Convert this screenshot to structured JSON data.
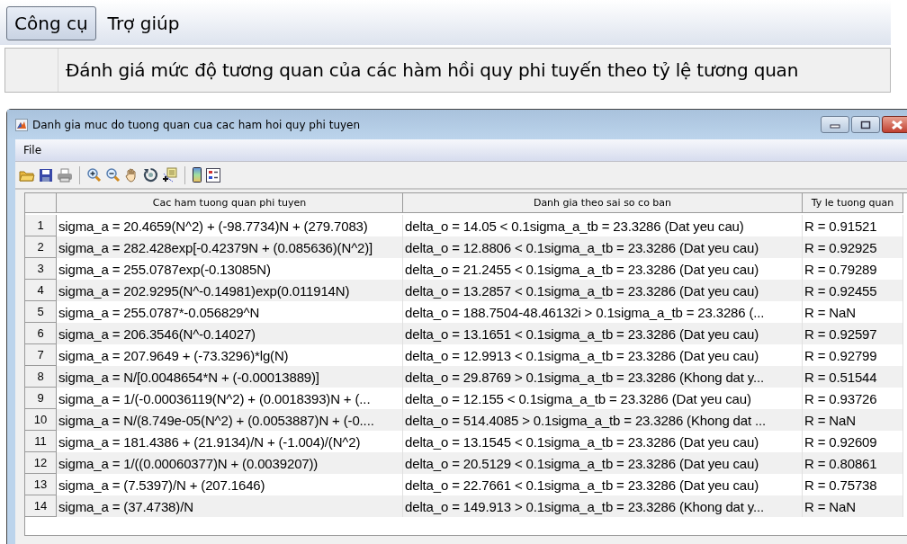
{
  "menu_bar": {
    "items": [
      {
        "label": "Công cụ",
        "selected": true
      },
      {
        "label": "Trợ giúp",
        "selected": false
      }
    ]
  },
  "menu_item": {
    "label": "Đánh giá mức độ tương quan của các hàm hồi quy phi tuyến theo tỷ lệ tương quan"
  },
  "window": {
    "title": "Danh gia muc do tuong quan cua cac ham hoi quy phi tuyen",
    "menu": [
      "File"
    ]
  },
  "table": {
    "columns": [
      "Cac ham tuong quan phi tuyen",
      "Danh gia theo sai so co ban",
      "Ty le tuong quan"
    ],
    "rows": [
      {
        "index": "1",
        "cells": [
          "sigma_a = 20.4659(N^2) + (-98.7734)N + (279.7083)",
          "delta_o = 14.05 < 0.1sigma_a_tb = 23.3286 (Dat yeu cau)",
          "R = 0.91521"
        ]
      },
      {
        "index": "2",
        "cells": [
          "sigma_a = 282.428exp[-0.42379N + (0.085636)(N^2)]",
          "delta_o = 12.8806 < 0.1sigma_a_tb = 23.3286 (Dat yeu cau)",
          "R = 0.92925"
        ]
      },
      {
        "index": "3",
        "cells": [
          "sigma_a = 255.0787exp(-0.13085N)",
          "delta_o = 21.2455 < 0.1sigma_a_tb = 23.3286 (Dat yeu cau)",
          "R = 0.79289"
        ]
      },
      {
        "index": "4",
        "cells": [
          "sigma_a = 202.9295(N^-0.14981)exp(0.011914N)",
          "delta_o = 13.2857 < 0.1sigma_a_tb = 23.3286 (Dat yeu cau)",
          "R = 0.92455"
        ]
      },
      {
        "index": "5",
        "cells": [
          "sigma_a = 255.0787*-0.056829^N",
          "delta_o = 188.7504-48.46132i > 0.1sigma_a_tb = 23.3286 (...",
          "R = NaN"
        ]
      },
      {
        "index": "6",
        "cells": [
          "sigma_a = 206.3546(N^-0.14027)",
          "delta_o = 13.1651 < 0.1sigma_a_tb = 23.3286 (Dat yeu cau)",
          "R = 0.92597"
        ]
      },
      {
        "index": "7",
        "cells": [
          "sigma_a = 207.9649 + (-73.3296)*lg(N)",
          "delta_o = 12.9913 < 0.1sigma_a_tb = 23.3286 (Dat yeu cau)",
          "R = 0.92799"
        ]
      },
      {
        "index": "8",
        "cells": [
          "sigma_a = N/[0.0048654*N + (-0.00013889)]",
          "delta_o = 29.8769 > 0.1sigma_a_tb = 23.3286 (Khong dat y...",
          "R = 0.51544"
        ]
      },
      {
        "index": "9",
        "cells": [
          "sigma_a = 1/(-0.00036119(N^2) + (0.0018393)N + (...",
          "delta_o = 12.155 < 0.1sigma_a_tb = 23.3286 (Dat yeu cau)",
          "R = 0.93726"
        ]
      },
      {
        "index": "10",
        "cells": [
          "sigma_a = N/(8.749e-05(N^2) + (0.0053887)N + (-0....",
          "delta_o = 514.4085 > 0.1sigma_a_tb = 23.3286 (Khong dat ...",
          "R = NaN"
        ]
      },
      {
        "index": "11",
        "cells": [
          "sigma_a = 181.4386 + (21.9134)/N + (-1.004)/(N^2)",
          "delta_o = 13.1545 < 0.1sigma_a_tb = 23.3286 (Dat yeu cau)",
          "R = 0.92609"
        ]
      },
      {
        "index": "12",
        "cells": [
          "sigma_a = 1/((0.00060377)N + (0.0039207))",
          "delta_o = 20.5129 < 0.1sigma_a_tb = 23.3286 (Dat yeu cau)",
          "R = 0.80861"
        ]
      },
      {
        "index": "13",
        "cells": [
          "sigma_a = (7.5397)/N + (207.1646)",
          "delta_o = 22.7661 < 0.1sigma_a_tb = 23.3286 (Dat yeu cau)",
          "R = 0.75738"
        ]
      },
      {
        "index": "14",
        "cells": [
          "sigma_a = (37.4738)/N",
          "delta_o = 149.913 > 0.1sigma_a_tb = 23.3286 (Khong dat y...",
          "R = NaN"
        ]
      }
    ]
  }
}
